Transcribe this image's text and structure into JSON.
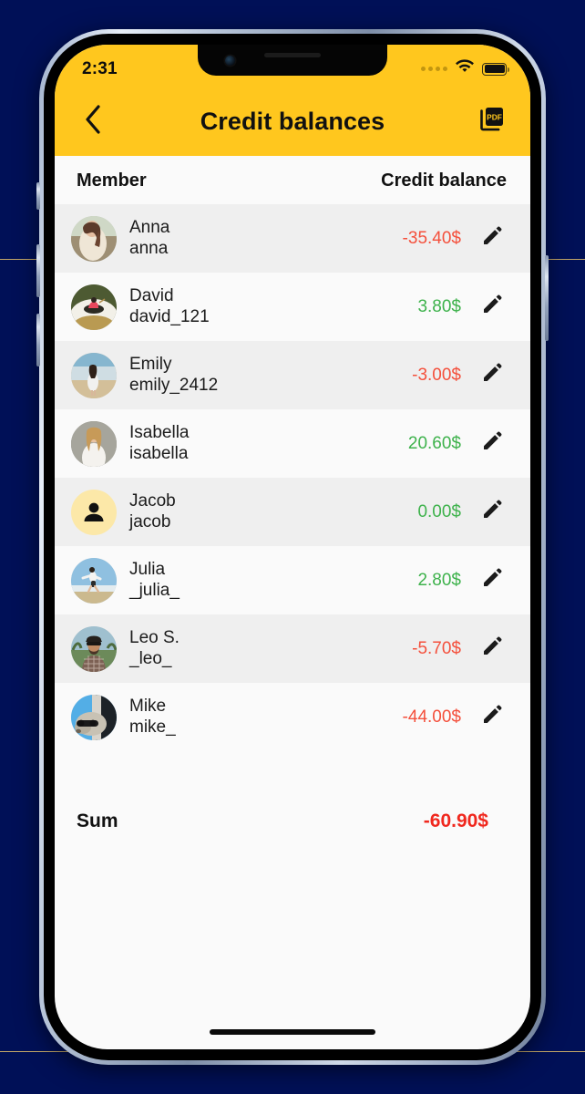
{
  "backdrop": {
    "color": "#001057",
    "accent_line_color": "#E8C36A"
  },
  "status_bar": {
    "time": "2:31",
    "signal_icon": "signal-dots-icon",
    "wifi_icon": "wifi-icon",
    "battery_icon": "battery-full-icon"
  },
  "navbar": {
    "back_icon": "chevron-left-icon",
    "title": "Credit balances",
    "pdf_icon": "pdf-export-icon",
    "background": "#FFC71E"
  },
  "table": {
    "columns": {
      "member": "Member",
      "balance": "Credit balance"
    },
    "rows": [
      {
        "name": "Anna",
        "handle": "anna",
        "amount": "-35.40$",
        "sign": "neg",
        "avatar": "photo-anna",
        "edit_icon": "edit-pencil-icon"
      },
      {
        "name": "David",
        "handle": "david_121",
        "amount": "3.80$",
        "sign": "pos",
        "avatar": "photo-david",
        "edit_icon": "edit-pencil-icon"
      },
      {
        "name": "Emily",
        "handle": "emily_2412",
        "amount": "-3.00$",
        "sign": "neg",
        "avatar": "photo-emily",
        "edit_icon": "edit-pencil-icon"
      },
      {
        "name": "Isabella",
        "handle": "isabella",
        "amount": "20.60$",
        "sign": "pos",
        "avatar": "photo-isabella",
        "edit_icon": "edit-pencil-icon"
      },
      {
        "name": "Jacob",
        "handle": "jacob",
        "amount": "0.00$",
        "sign": "pos",
        "avatar": "avatar-placeholder-person",
        "edit_icon": "edit-pencil-icon"
      },
      {
        "name": "Julia",
        "handle": "_julia_",
        "amount": "2.80$",
        "sign": "pos",
        "avatar": "photo-julia",
        "edit_icon": "edit-pencil-icon"
      },
      {
        "name": "Leo S.",
        "handle": "_leo_",
        "amount": "-5.70$",
        "sign": "neg",
        "avatar": "photo-leo",
        "edit_icon": "edit-pencil-icon"
      },
      {
        "name": "Mike",
        "handle": "mike_",
        "amount": "-44.00$",
        "sign": "neg",
        "avatar": "photo-mike",
        "edit_icon": "edit-pencil-icon"
      }
    ]
  },
  "summary": {
    "label": "Sum",
    "value": "-60.90$"
  },
  "colors": {
    "brand_yellow": "#FFC71E",
    "negative": "#F4503C",
    "positive": "#3EB24C",
    "sum_negative": "#F0281E",
    "row_alt": "#EFEFEF",
    "row_base": "#FAFAFA"
  },
  "home_indicator": "home-indicator"
}
